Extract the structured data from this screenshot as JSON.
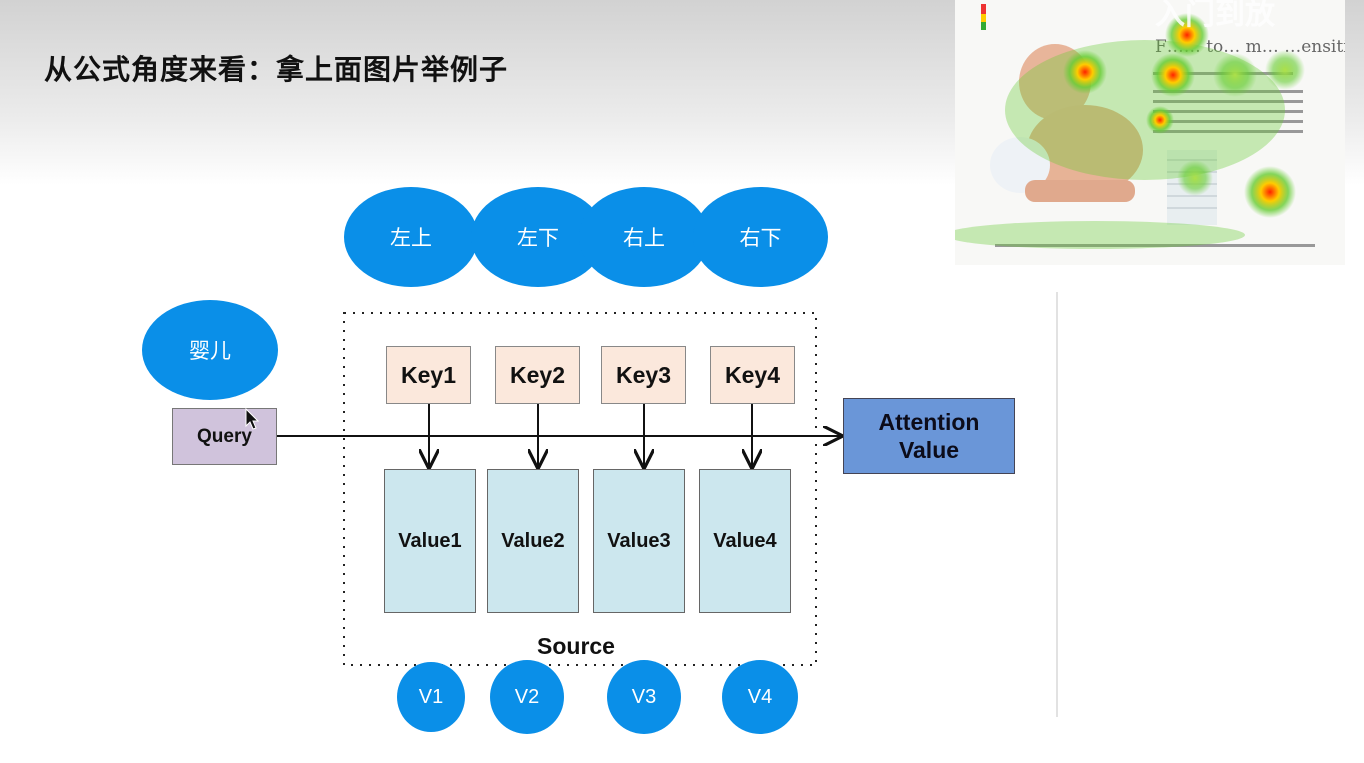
{
  "title": "从公式角度来看：拿上面图片举例子",
  "top_ovals": [
    "左上",
    "左下",
    "右上",
    "右下"
  ],
  "query_oval": "婴儿",
  "query_label": "Query",
  "keys": [
    "Key1",
    "Key2",
    "Key3",
    "Key4"
  ],
  "values": [
    "Value1",
    "Value2",
    "Value3",
    "Value4"
  ],
  "output": {
    "line1": "Attention",
    "line2": "Value"
  },
  "source_label": "Source",
  "bottom_circles": [
    "V1",
    "V2",
    "V3",
    "V4"
  ],
  "heatmap_caption": "F……  to…  m… …ensitive skin.",
  "heatmap_watermark": "入门到放"
}
